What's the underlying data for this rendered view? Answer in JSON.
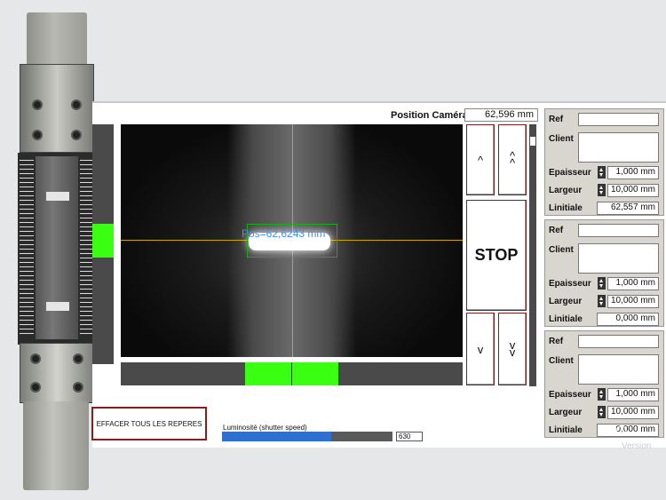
{
  "header": {
    "position_label": "Position Caméra",
    "position_value": "62,596 mm"
  },
  "camera": {
    "overlay_text": "Pos=62,6243 mm"
  },
  "controls": {
    "up_single": "^",
    "up_double": "^\n^",
    "stop": "STOP",
    "down_single": "v",
    "down_double": "v\nv"
  },
  "bottom": {
    "clear_button": "EFFACER TOUS LES REPERES",
    "luminosity_label": "Luminosité (shutter speed)",
    "luminosity_value": "630",
    "luminosity_level_percent": 64
  },
  "panels": [
    {
      "ref_label": "Ref",
      "ref_value": "",
      "client_label": "Client",
      "client_value": "",
      "thickness_label": "Epaisseur",
      "thickness_value": "1,000 mm",
      "width_label": "Largeur",
      "width_value": "10,000 mm",
      "initial_label": "Linitiale",
      "initial_value": "62,557 mm"
    },
    {
      "ref_label": "Ref",
      "ref_value": "",
      "client_label": "Client",
      "client_value": "",
      "thickness_label": "Epaisseur",
      "thickness_value": "1,000 mm",
      "width_label": "Largeur",
      "width_value": "10,000 mm",
      "initial_label": "Linitiale",
      "initial_value": "0,000 mm"
    },
    {
      "ref_label": "Ref",
      "ref_value": "",
      "client_label": "Client",
      "client_value": "",
      "thickness_label": "Epaisseur",
      "thickness_value": "1,000 mm",
      "width_label": "Largeur",
      "width_value": "10,000 mm",
      "initial_label": "Linitiale",
      "initial_value": "0,000 mm"
    }
  ],
  "watermark": {
    "line1": "Yo",
    "line2": "Version"
  },
  "colors": {
    "indicator_green": "#3aff13",
    "stop_border": "#7a2020",
    "luminosity_blue": "#2f6fd0"
  }
}
